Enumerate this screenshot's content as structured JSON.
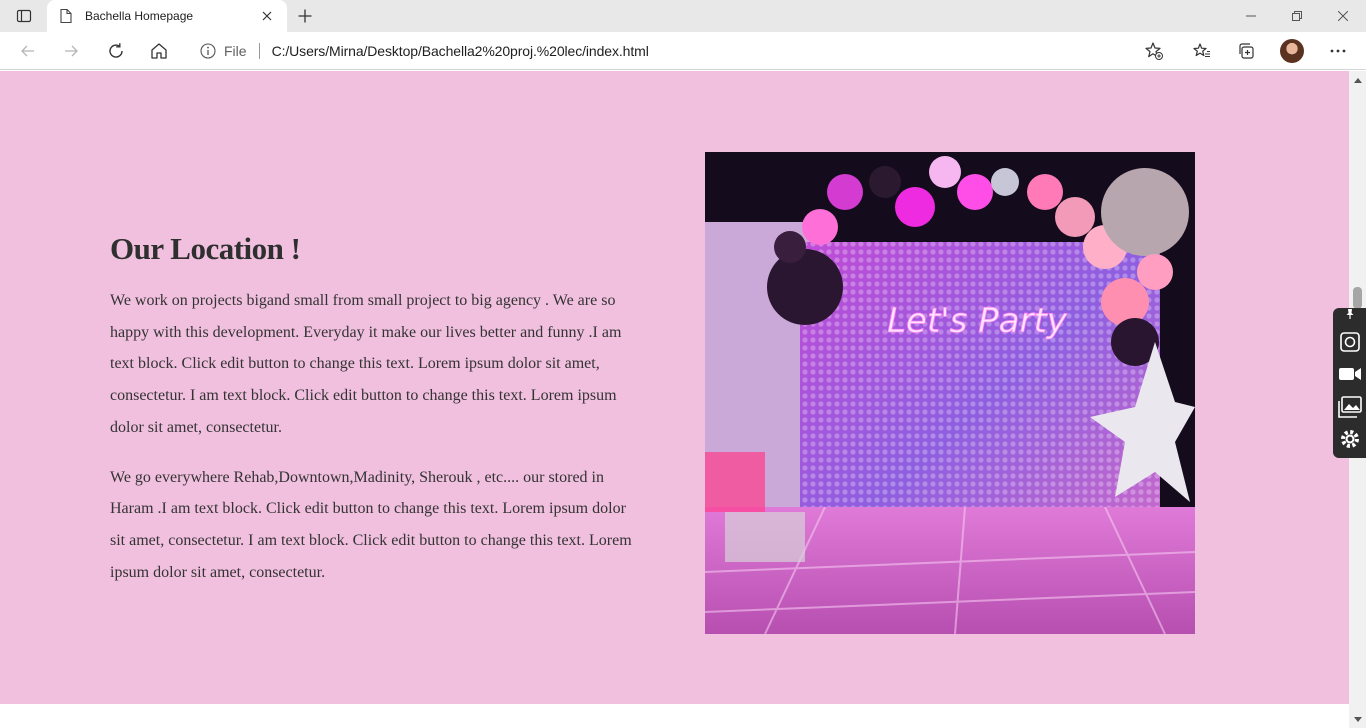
{
  "browser": {
    "tab_title": "Bachella Homepage",
    "address": {
      "scheme_label": "File",
      "url": "C:/Users/Mirna/Desktop/Bachella2%20proj.%20lec/index.html"
    }
  },
  "page": {
    "background_color": "#f1c0df",
    "location": {
      "heading": "Our Location !",
      "paragraphs": [
        "We work on projects bigand small from small project to big agency . We are so happy with this development. Everyday it make our lives better and funny .I am text block. Click edit button to change this text. Lorem ipsum dolor sit amet, consectetur. I am text block. Click edit button to change this text. Lorem ipsum dolor sit amet, consectetur.",
        "We go everywhere Rehab,Downtown,Madinity, Sherouk , etc.... our stored in Haram .I am text block. Click edit button to change this text. Lorem ipsum dolor sit amet, consectetur. I am text block. Click edit button to change this text. Lorem ipsum dolor sit amet, consectetur."
      ],
      "image": {
        "neon_sign": "Let's Party"
      }
    }
  },
  "icons": [
    "sidebar-icon",
    "page-icon",
    "close-icon",
    "plus-icon",
    "minimize-icon",
    "restore-icon",
    "window-close-icon",
    "back-icon",
    "forward-icon",
    "refresh-icon",
    "home-icon",
    "info-icon",
    "add-favorite-icon",
    "favorites-icon",
    "collections-icon",
    "more-icon",
    "camera-icon",
    "video-icon",
    "gallery-icon",
    "settings-icon",
    "pin-icon"
  ]
}
